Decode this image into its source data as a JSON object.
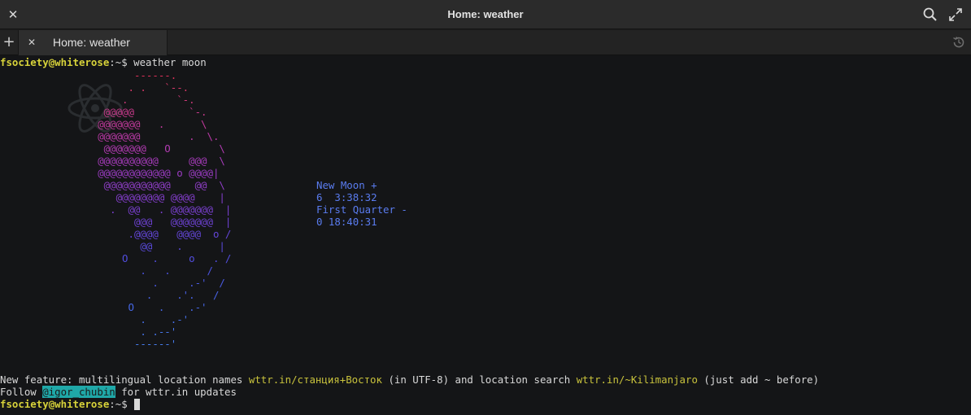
{
  "window": {
    "title": "Home: weather",
    "tab_label": "Home: weather",
    "close_glyph": "✕",
    "newtab_glyph": "+",
    "tabclose_glyph": "✕"
  },
  "terminal": {
    "prompt": {
      "user": "fsociety",
      "at": "@",
      "host": "whiterose",
      "path": ":~$ "
    },
    "command": "weather moon",
    "moon_info": {
      "line1": "New Moon +",
      "line2": "6  3:38:32",
      "line3": "First Quarter -",
      "line4": "0 18:40:31"
    },
    "feature_line": {
      "prefix": "New feature: multilingual location names ",
      "link1": "wttr.in/станция+Восток",
      "mid": " (in UTF-8) and location search ",
      "link2": "wttr.in/~Kilimanjaro",
      "suffix": " (just add ~ before)"
    },
    "follow_line": {
      "prefix": "Follow ",
      "handle": "@igor_chubin",
      "suffix": " for wttr.in updates"
    }
  },
  "moon_art": [
    {
      "t": "             ------.",
      "c": "#e0305a"
    },
    {
      "t": "            . .   `--.",
      "c": "#d93a6a"
    },
    {
      "t": "           .        `-.",
      "c": "#cf3a7a"
    },
    {
      "t": "        @@@@@         `-.",
      "c": "#c93a8c"
    },
    {
      "t": "       @@@@@@@   .      \\",
      "c": "#c23a9c"
    },
    {
      "t": "       @@@@@@@        .  \\.",
      "c": "#bb3aa8"
    },
    {
      "t": "        @@@@@@@   O        \\",
      "c": "#b43cb4"
    },
    {
      "t": "       @@@@@@@@@@     @@@  \\",
      "c": "#a83cbc"
    },
    {
      "t": "       @@@@@@@@@@@@ o @@@@|",
      "c": "#9c3cc4"
    },
    {
      "t": "        @@@@@@@@@@@    @@  \\",
      "c": "#903ec8"
    },
    {
      "t": "          @@@@@@@@ @@@@    |",
      "c": "#843ecc"
    },
    {
      "t": "         .  @@   . @@@@@@@  |",
      "c": "#7a40d0"
    },
    {
      "t": "             @@@   @@@@@@@  |",
      "c": "#6e42d4"
    },
    {
      "t": "            .@@@@   @@@@  o /",
      "c": "#6446d8"
    },
    {
      "t": "              @@    .      |",
      "c": "#5a4adc"
    },
    {
      "t": "           O    .     o   . /",
      "c": "#524ee0"
    },
    {
      "t": "              .   .      /",
      "c": "#4c54e2"
    },
    {
      "t": "                .     .-'  /",
      "c": "#4a5ae4"
    },
    {
      "t": "               .    .'.   /",
      "c": "#4862e6"
    },
    {
      "t": "            O    .    .-'",
      "c": "#4668e8"
    },
    {
      "t": "              .    .-'",
      "c": "#4670ea"
    },
    {
      "t": "              . .--'",
      "c": "#4676ea"
    },
    {
      "t": "             ------'",
      "c": "#467cec"
    }
  ]
}
